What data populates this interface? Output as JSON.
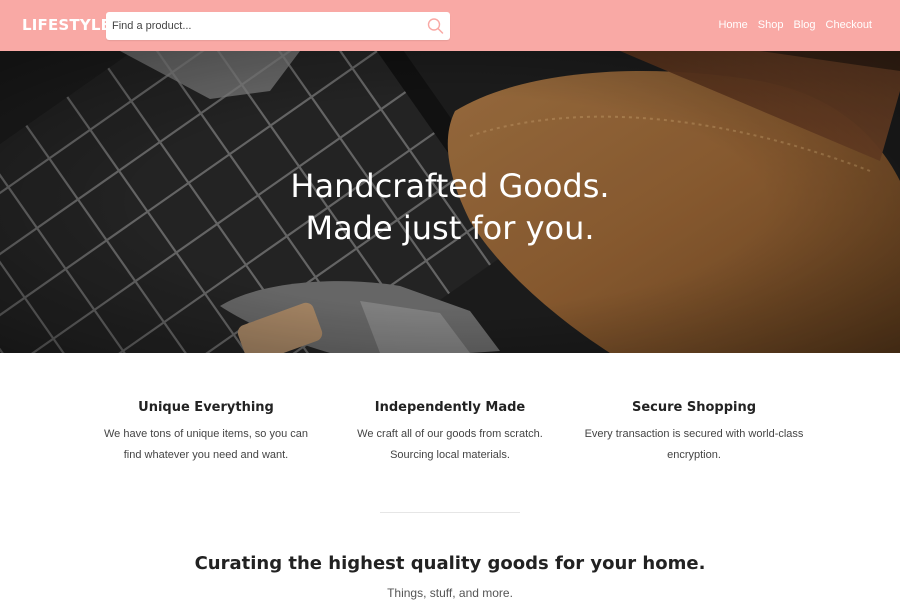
{
  "header": {
    "logo": "LIFESTYLE",
    "search_placeholder": "Find a product...",
    "search_icon": "search-icon",
    "nav": [
      "Home",
      "Shop",
      "Blog",
      "Checkout"
    ]
  },
  "hero": {
    "line1": "Handcrafted Goods.",
    "line2": "Made just for you."
  },
  "features": [
    {
      "title": "Unique Everything",
      "text": "We have tons of unique items, so you can find whatever you need and want."
    },
    {
      "title": "Independently Made",
      "text": "We craft all of our goods from scratch. Sourcing local materials."
    },
    {
      "title": "Secure Shopping",
      "text": "Every transaction is secured with world-class encryption."
    }
  ],
  "tagline": "Curating the highest quality goods for your home.",
  "subtagline": "Things, stuff, and more.",
  "colors": {
    "header_bg": "#f9a9a5",
    "text_dark": "#222222"
  }
}
